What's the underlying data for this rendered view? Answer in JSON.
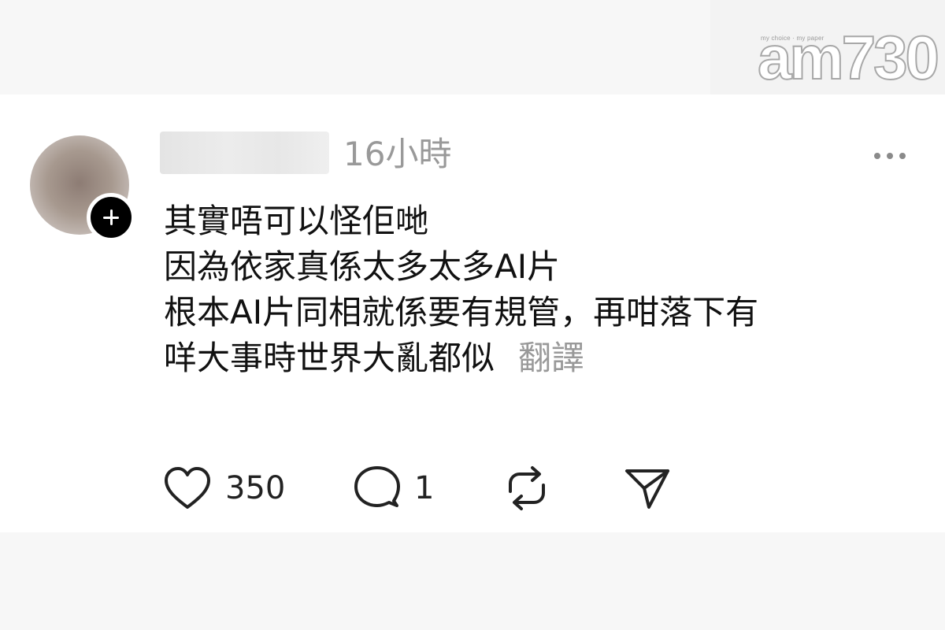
{
  "watermark": {
    "tagline": "my choice · my paper",
    "logo": "am730"
  },
  "post": {
    "timestamp": "16小時",
    "lines": [
      "其實唔可以怪佢哋",
      "因為依家真係太多太多AI片",
      "根本AI片同相就係要有規管，再咁落下有",
      "咩大事時世界大亂都似"
    ],
    "translate_label": "翻譯",
    "icons": {
      "avatar": "avatar",
      "follow": "plus-icon",
      "more": "more-horizontal-icon",
      "like": "heart-icon",
      "reply": "comment-icon",
      "repost": "repost-icon",
      "share": "send-icon"
    }
  },
  "actions": {
    "like_count": "350",
    "reply_count": "1"
  },
  "colors": {
    "text_primary": "#111111",
    "text_secondary": "#999999",
    "icon": "#222222"
  }
}
